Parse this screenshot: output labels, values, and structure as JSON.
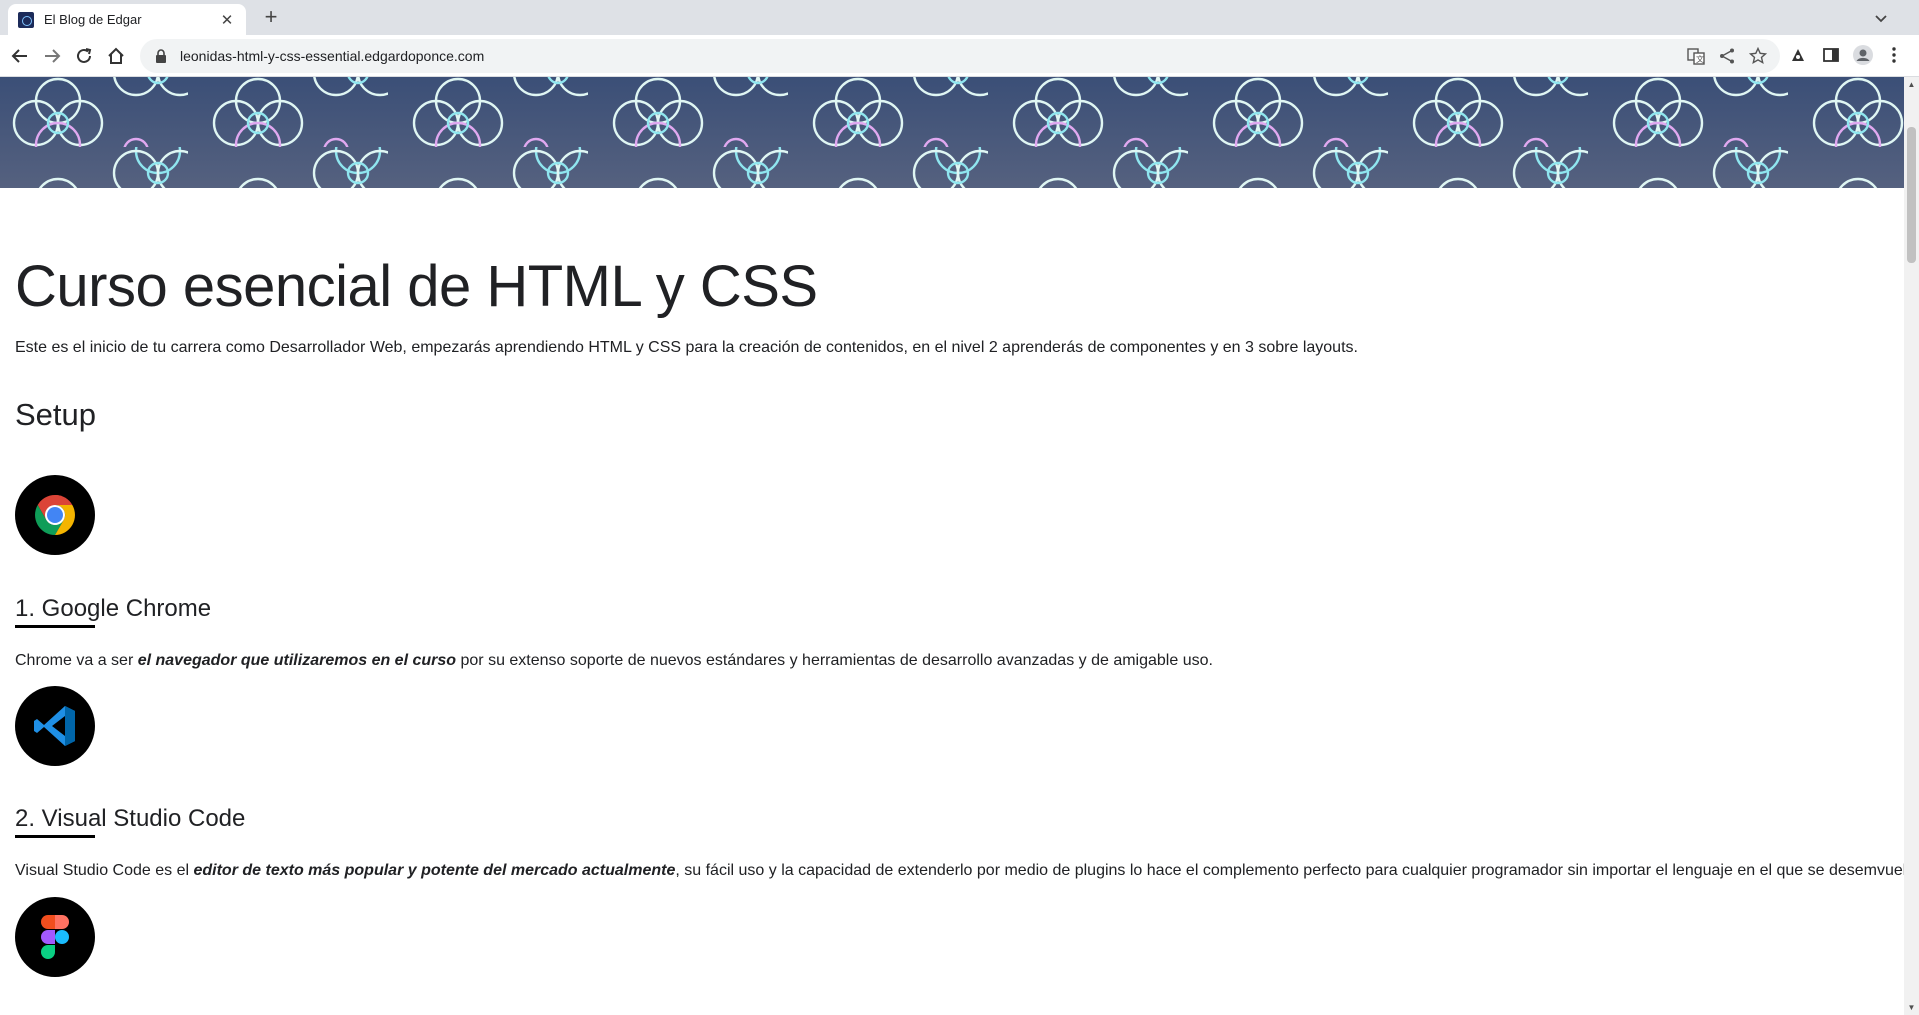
{
  "browser": {
    "tab_title": "El Blog de Edgar",
    "url": "leonidas-html-y-css-essential.edgardoponce.com"
  },
  "page": {
    "title": "Curso esencial de HTML y CSS",
    "intro": "Este es el inicio de tu carrera como Desarrollador Web, empezarás aprendiendo HTML y CSS para la creación de contenidos, en el nivel 2 aprenderás de componentes y en 3 sobre layouts.",
    "setup_heading": "Setup",
    "tools": [
      {
        "heading": "1. Google Chrome",
        "desc_before": "Chrome va a ser ",
        "desc_bold": "el navegador que utilizaremos en el curso",
        "desc_after": " por su extenso soporte de nuevos estándares y herramientas de desarrollo avanzadas y de amigable uso.",
        "icon": "chrome-icon"
      },
      {
        "heading": "2. Visual Studio Code",
        "desc_before": "Visual Studio Code es el ",
        "desc_bold": "editor de texto más popular y potente del mercado actualmente",
        "desc_after": ", su fácil uso y la capacidad de extenderlo por medio de plugins lo hace el complemento perfecto para cualquier programador sin importar el lenguaje en el que se desemvuelva.",
        "icon": "vscode-icon"
      },
      {
        "icon": "figma-icon"
      }
    ]
  },
  "colors": {
    "banner_top": "#3b4f77",
    "banner_bottom": "#55617f",
    "pattern_cyan": "#8fe6ef",
    "pattern_pink": "#e0a8f0",
    "pattern_white": "#dff6f3"
  }
}
